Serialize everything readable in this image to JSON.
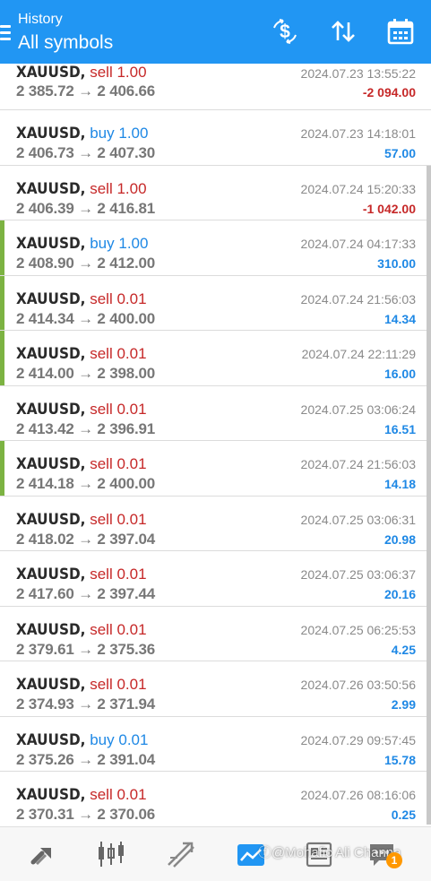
{
  "header": {
    "subtitle": "History",
    "title": "All symbols",
    "icons": [
      "menu-icon",
      "currency-icon",
      "sort-icon",
      "calendar-icon"
    ],
    "background": "#2196f3"
  },
  "trades": [
    {
      "symbol": "XAUUSD,",
      "type": "sell",
      "volume": "1.00",
      "prices": "2 385.72 → 2 406.66",
      "time": "2024.07.23 13:55:22",
      "profit": "-2 094.00",
      "positive": false,
      "marked": false
    },
    {
      "symbol": "XAUUSD,",
      "type": "buy",
      "volume": "1.00",
      "prices": "2 406.73 → 2 407.30",
      "time": "2024.07.23 14:18:01",
      "profit": "57.00",
      "positive": true,
      "marked": false
    },
    {
      "symbol": "XAUUSD,",
      "type": "sell",
      "volume": "1.00",
      "prices": "2 406.39 → 2 416.81",
      "time": "2024.07.24 15:20:33",
      "profit": "-1 042.00",
      "positive": false,
      "marked": false
    },
    {
      "symbol": "XAUUSD,",
      "type": "buy",
      "volume": "1.00",
      "prices": "2 408.90 → 2 412.00",
      "time": "2024.07.24 04:17:33",
      "profit": "310.00",
      "positive": true,
      "marked": true
    },
    {
      "symbol": "XAUUSD,",
      "type": "sell",
      "volume": "0.01",
      "prices": "2 414.34 → 2 400.00",
      "time": "2024.07.24 21:56:03",
      "profit": "14.34",
      "positive": true,
      "marked": true
    },
    {
      "symbol": "XAUUSD,",
      "type": "sell",
      "volume": "0.01",
      "prices": "2 414.00 → 2 398.00",
      "time": "2024.07.24 22:11:29",
      "profit": "16.00",
      "positive": true,
      "marked": true
    },
    {
      "symbol": "XAUUSD,",
      "type": "sell",
      "volume": "0.01",
      "prices": "2 413.42 → 2 396.91",
      "time": "2024.07.25 03:06:24",
      "profit": "16.51",
      "positive": true,
      "marked": false
    },
    {
      "symbol": "XAUUSD,",
      "type": "sell",
      "volume": "0.01",
      "prices": "2 414.18 → 2 400.00",
      "time": "2024.07.24 21:56:03",
      "profit": "14.18",
      "positive": true,
      "marked": true
    },
    {
      "symbol": "XAUUSD,",
      "type": "sell",
      "volume": "0.01",
      "prices": "2 418.02 → 2 397.04",
      "time": "2024.07.25 03:06:31",
      "profit": "20.98",
      "positive": true,
      "marked": false
    },
    {
      "symbol": "XAUUSD,",
      "type": "sell",
      "volume": "0.01",
      "prices": "2 417.60 → 2 397.44",
      "time": "2024.07.25 03:06:37",
      "profit": "20.16",
      "positive": true,
      "marked": false
    },
    {
      "symbol": "XAUUSD,",
      "type": "sell",
      "volume": "0.01",
      "prices": "2 379.61 → 2 375.36",
      "time": "2024.07.25 06:25:53",
      "profit": "4.25",
      "positive": true,
      "marked": false
    },
    {
      "symbol": "XAUUSD,",
      "type": "sell",
      "volume": "0.01",
      "prices": "2 374.93 → 2 371.94",
      "time": "2024.07.26 03:50:56",
      "profit": "2.99",
      "positive": true,
      "marked": false
    },
    {
      "symbol": "XAUUSD,",
      "type": "buy",
      "volume": "0.01",
      "prices": "2 375.26 → 2 391.04",
      "time": "2024.07.29 09:57:45",
      "profit": "15.78",
      "positive": true,
      "marked": false
    },
    {
      "symbol": "XAUUSD,",
      "type": "sell",
      "volume": "0.01",
      "prices": "2 370.31 → 2 370.06",
      "time": "2024.07.26 08:16:06",
      "profit": "0.25",
      "positive": true,
      "marked": false
    }
  ],
  "bottom_nav": {
    "items": [
      "quotes-icon",
      "chart-icon",
      "trade-icon",
      "history-icon",
      "news-icon",
      "chat-icon"
    ],
    "active": "history-icon",
    "watermark": "ⓕ@Mohafic Ali Channa",
    "badge": "1"
  },
  "colors": {
    "sell": "#c62828",
    "buy": "#1e88e5",
    "marker": "#7cb342"
  }
}
